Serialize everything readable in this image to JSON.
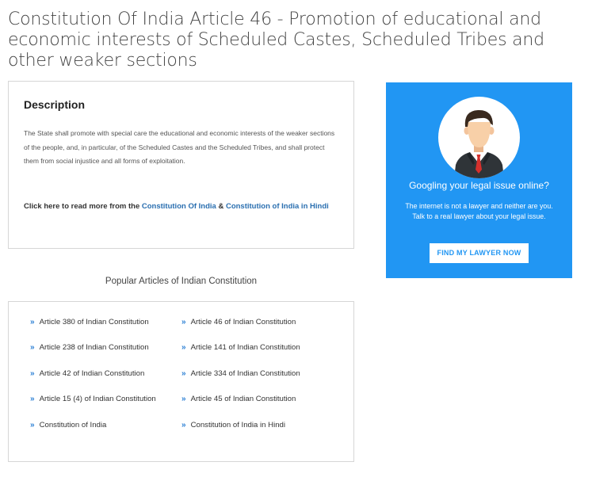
{
  "page": {
    "title": "Constitution Of India Article 46 - Promotion of educational and economic interests of Scheduled Castes, Scheduled Tribes and other weaker sections"
  },
  "description": {
    "heading": "Description",
    "body": "The State shall promote with special care the educational and economic interests of the weaker sections of the people, and, in particular, of the Scheduled Castes and the Scheduled Tribes, and shall protect them from social injustice and all forms of exploitation.",
    "read_more_prefix": "Click here to read more from the ",
    "link_constitution": "Constitution Of India",
    "separator": " & ",
    "link_constitution_hindi": "Constitution of India in Hindi"
  },
  "promo": {
    "heading": "Googling your legal issue online?",
    "line1": "The internet is not a lawyer and neither are you.",
    "line2": "Talk to a real lawyer about your legal issue.",
    "button_label": "FIND MY LAWYER NOW",
    "colors": {
      "background": "#2196f3",
      "button_text": "#2196f3"
    },
    "icon": "lawyer-avatar-icon"
  },
  "popular": {
    "heading": "Popular Articles of Indian Constitution",
    "chevron_glyph": "»",
    "items": [
      {
        "label": "Article 380 of Indian Constitution"
      },
      {
        "label": "Article 46 of Indian Constitution"
      },
      {
        "label": "Article 238 of Indian Constitution"
      },
      {
        "label": "Article 141 of Indian Constitution"
      },
      {
        "label": "Article 42 of Indian Constitution"
      },
      {
        "label": "Article 334 of Indian Constitution"
      },
      {
        "label": "Article 15 (4) of Indian Constitution"
      },
      {
        "label": "Article 45 of Indian Constitution"
      },
      {
        "label": "Constitution of India"
      },
      {
        "label": "Constitution of India in Hindi"
      }
    ]
  }
}
